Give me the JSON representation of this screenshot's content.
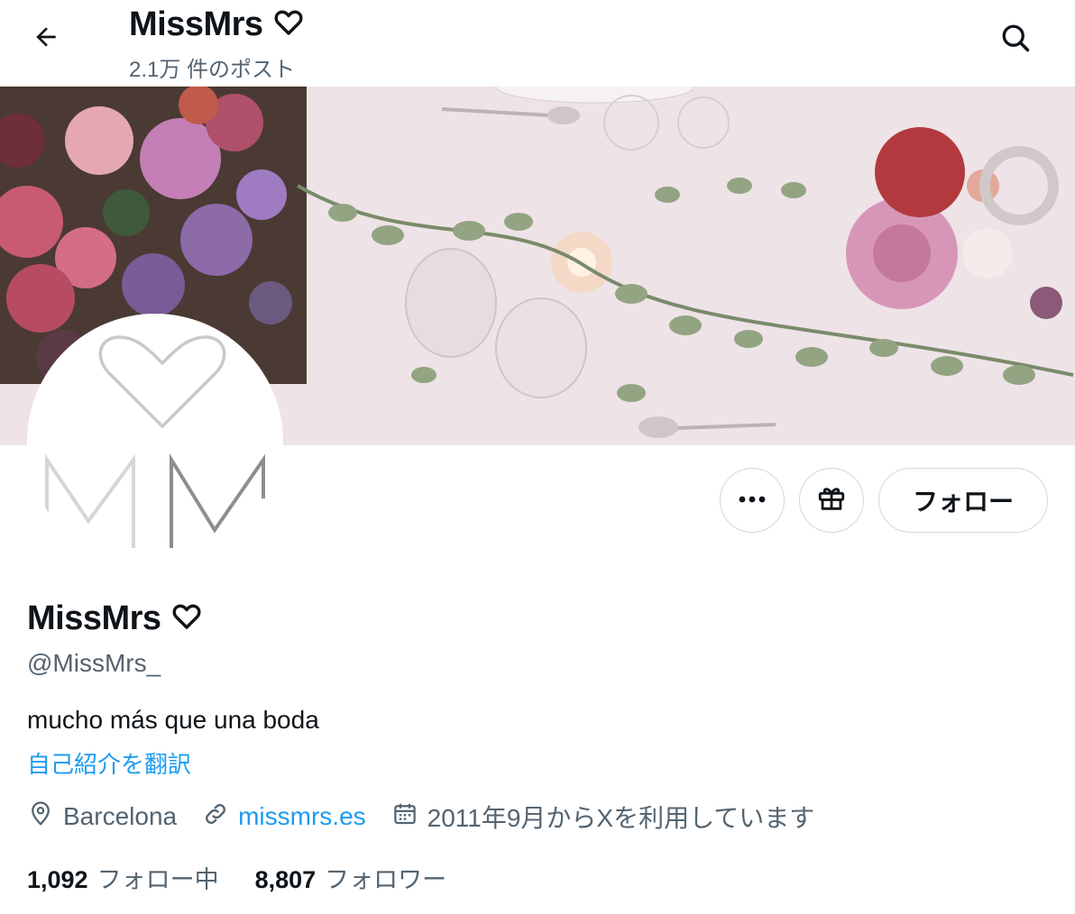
{
  "header": {
    "title": "MissMrs",
    "post_count": "2.1万 件のポスト",
    "back_icon": "arrow-left-icon",
    "search_icon": "search-icon"
  },
  "profile": {
    "display_name": "MissMrs",
    "name_icon": "heart-outline-icon",
    "handle": "@MissMrs_",
    "bio": "mucho más que una boda",
    "translate_label": "自己紹介を翻訳",
    "avatar_text": "MM",
    "location": "Barcelona",
    "website": "missmrs.es",
    "joined": "2011年9月からXを利用しています"
  },
  "actions": {
    "more_icon": "more-dots-icon",
    "gift_icon": "gift-icon",
    "follow_label": "フォロー"
  },
  "stats": {
    "following_count": "1,092",
    "following_label": "フォロー中",
    "followers_count": "8,807",
    "followers_label": "フォロワー"
  },
  "colors": {
    "text_primary": "#0f1419",
    "text_secondary": "#536471",
    "link": "#1d9bf0",
    "border": "#cfd9de"
  }
}
